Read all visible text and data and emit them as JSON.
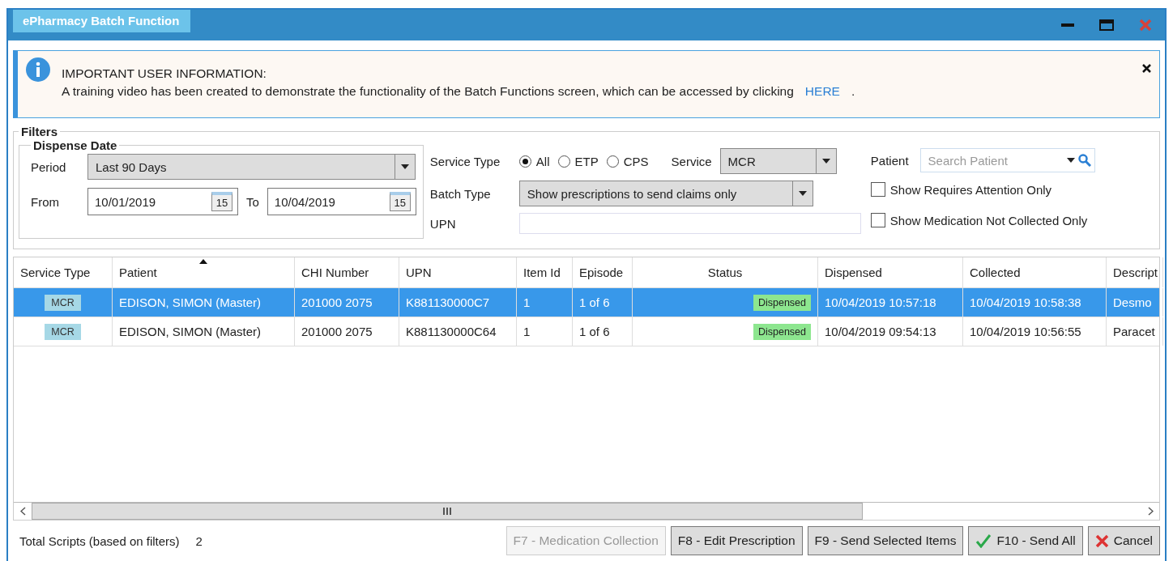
{
  "window": {
    "title": "ePharmacy Batch Function"
  },
  "notice": {
    "heading": "IMPORTANT USER INFORMATION:",
    "text": "A training video has been created to demonstrate the functionality of the Batch Functions screen, which can be accessed by clicking",
    "link": "HERE",
    "trailing": "."
  },
  "filters": {
    "title": "Filters",
    "dispense_date": {
      "title": "Dispense Date",
      "period_label": "Period",
      "period": "Last 90 Days",
      "from_label": "From",
      "from": "10/01/2019",
      "from_calendar_day": "15",
      "to_label": "To",
      "to": "10/04/2019",
      "to_calendar_day": "15"
    },
    "service_type": {
      "label": "Service Type",
      "options": [
        {
          "label": "All",
          "selected": true
        },
        {
          "label": "ETP",
          "selected": false
        },
        {
          "label": "CPS",
          "selected": false
        }
      ]
    },
    "service": {
      "label": "Service",
      "value": "MCR"
    },
    "batch_type": {
      "label": "Batch Type",
      "value": "Show prescriptions to send claims only"
    },
    "upn": {
      "label": "UPN"
    },
    "patient": {
      "label": "Patient",
      "placeholder": "Search Patient"
    },
    "checkboxes": [
      {
        "label": "Show Requires Attention Only",
        "checked": false
      },
      {
        "label": "Show Medication Not Collected Only",
        "checked": false
      }
    ]
  },
  "table": {
    "columns": [
      {
        "label": "Service Type",
        "sorted": false
      },
      {
        "label": "Patient",
        "sorted": true
      },
      {
        "label": "CHI Number",
        "sorted": false
      },
      {
        "label": "UPN",
        "sorted": false
      },
      {
        "label": "Item Id",
        "sorted": false
      },
      {
        "label": "Episode",
        "sorted": false
      },
      {
        "label": "Status",
        "sorted": false
      },
      {
        "label": "Dispensed",
        "sorted": false
      },
      {
        "label": "Collected",
        "sorted": false
      },
      {
        "label": "Descript",
        "sorted": false
      }
    ],
    "rows": [
      {
        "selected": true,
        "cells": [
          "MCR",
          "EDISON, SIMON (Master)",
          "201000 2075",
          "K881130000C7",
          "1",
          "1 of 6",
          "Dispensed",
          "10/04/2019 10:57:18",
          "10/04/2019 10:58:38",
          "Desmo"
        ]
      },
      {
        "selected": false,
        "cells": [
          "MCR",
          "EDISON, SIMON (Master)",
          "201000 2075",
          "K881130000C64",
          "1",
          "1 of 6",
          "Dispensed",
          "10/04/2019 09:54:13",
          "10/04/2019 10:56:55",
          "Paracet"
        ]
      }
    ]
  },
  "footer": {
    "total_label": "Total Scripts (based on filters)",
    "total": "2",
    "buttons": [
      {
        "label": "F7 - Medication Collection",
        "kind": "plain",
        "disabled": true
      },
      {
        "label": "F8 - Edit Prescription",
        "kind": "plain",
        "disabled": false
      },
      {
        "label": "F9 - Send Selected Items",
        "kind": "plain",
        "disabled": false
      },
      {
        "label": "F10 - Send All",
        "kind": "confirm",
        "disabled": false
      },
      {
        "label": "Cancel",
        "kind": "cancel",
        "disabled": false
      }
    ]
  }
}
